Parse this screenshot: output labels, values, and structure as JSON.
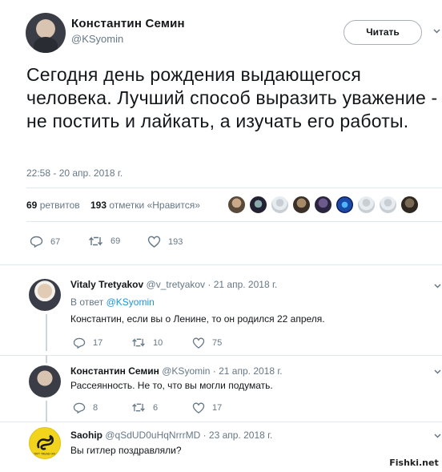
{
  "main_tweet": {
    "author_name": "Константин Семин",
    "author_handle": "@KSyomin",
    "follow_label": "Читать",
    "text": "Сегодня день рождения выдающегося человека. Лучший способ выразить уважение - не постить и лайкать, а изучать его работы.",
    "timestamp": "22:58 - 20 апр. 2018 г.",
    "retweets_count": "69",
    "retweets_label": "ретвитов",
    "likes_count": "193",
    "likes_label": "отметки «Нравится»",
    "actions": {
      "reply": "67",
      "retweet": "69",
      "like": "193"
    }
  },
  "replies": [
    {
      "author_name": "Vitaly Tretyakov",
      "author_handle": "@v_tretyakov",
      "date": "· 21 апр. 2018 г.",
      "reply_to_prefix": "В ответ",
      "reply_to_handle": "@KSyomin",
      "text": "Константин, если вы о Ленине, то он родился 22 апреля.",
      "actions": {
        "reply": "17",
        "retweet": "10",
        "like": "75"
      }
    },
    {
      "author_name": "Константин Семин",
      "author_handle": "@KSyomin",
      "date": "· 21 апр. 2018 г.",
      "text": "Рассеянность. Не то, что вы могли подумать.",
      "actions": {
        "reply": "8",
        "retweet": "6",
        "like": "17"
      }
    },
    {
      "author_name": "Saohip",
      "author_handle": "@qSdUD0uHqNrrrMD",
      "date": "· 23 апр. 2018 г.",
      "text": "Вы гитлер поздравляли?",
      "avatar_caption": "DON'T TREAD ON ME"
    }
  ],
  "watermark": "Fishki.net",
  "colors": {
    "text": "#14171a",
    "muted": "#657786",
    "link": "#1b95e0",
    "divider": "#e1e8ed",
    "thread_line": "#ccd6dd"
  }
}
